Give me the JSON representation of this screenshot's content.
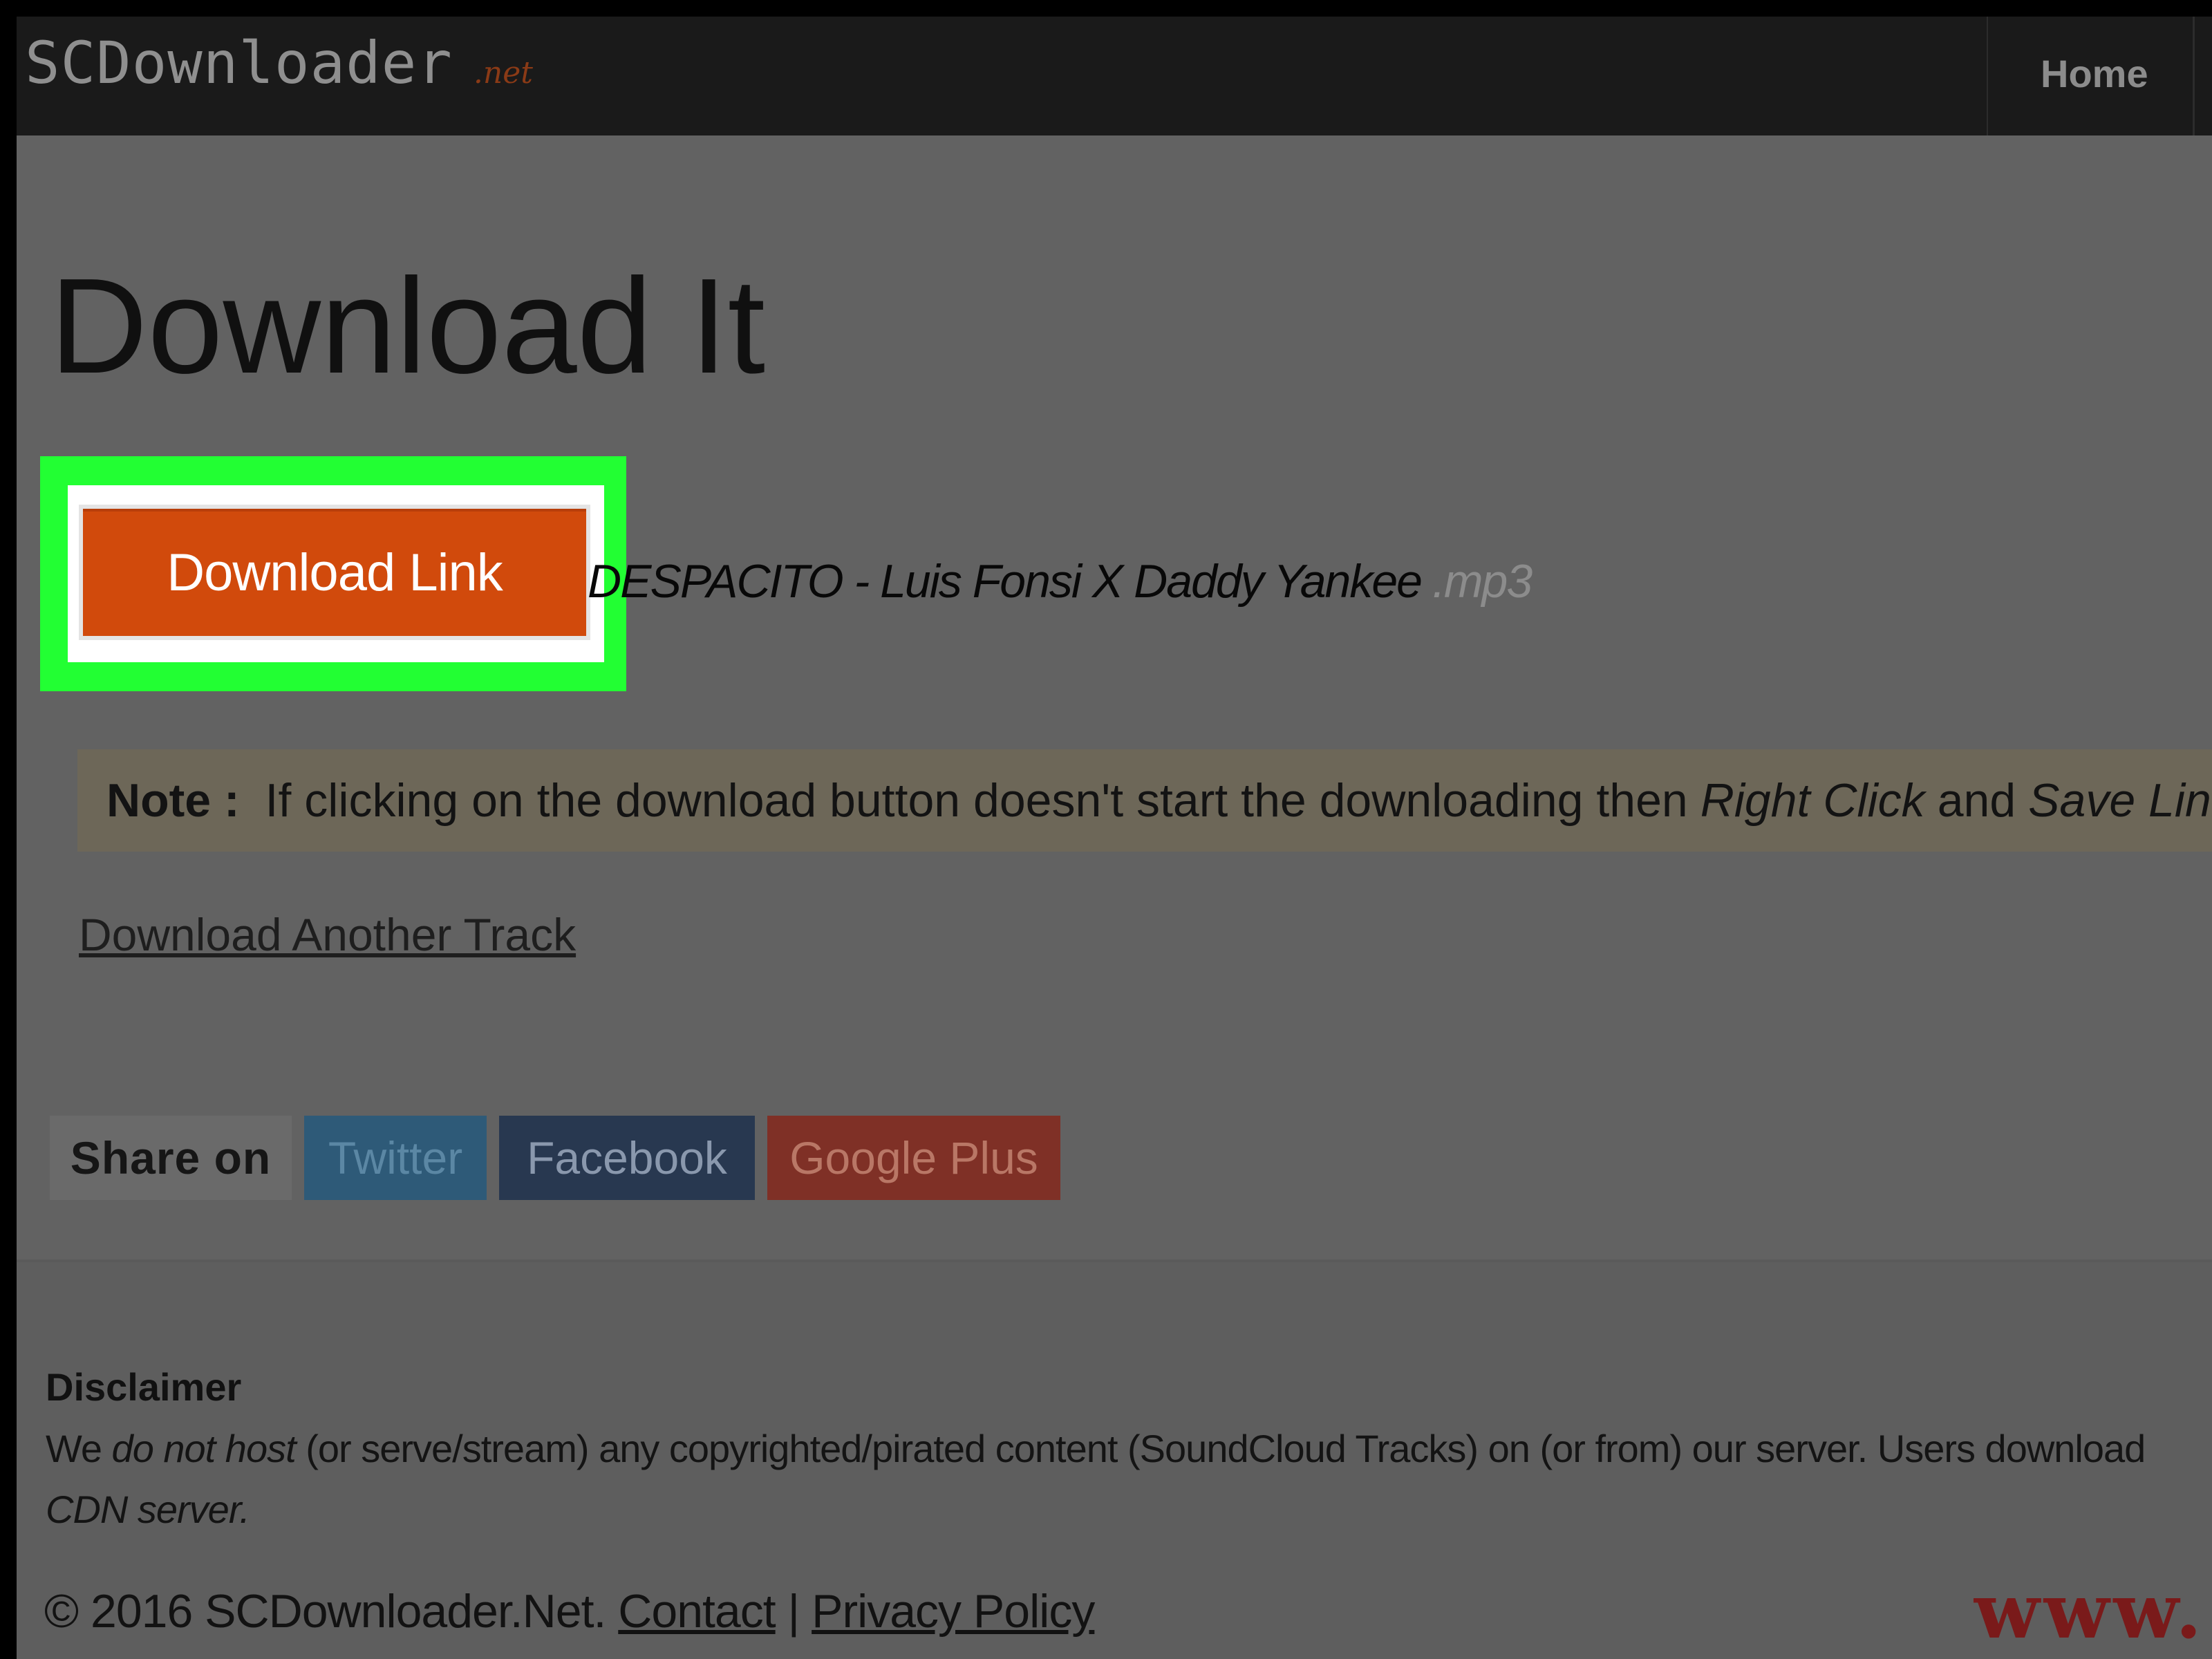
{
  "navbar": {
    "brand": "SCDownloader",
    "brand_tld": ".net",
    "home_label": "Home"
  },
  "main": {
    "title": "Download It",
    "download_button": "Download Link",
    "track_title": "DESPACITO - Luis Fonsi X Daddy Yankee",
    "track_ext": ".mp3",
    "note": {
      "label": "Note :",
      "text_before": " If clicking on the download button doesn't start the downloading then",
      "right_click": "Right Click",
      "text_and": "and",
      "save_link": "Save Link As"
    },
    "another_track": "Download Another Track"
  },
  "share": {
    "label": "Share on",
    "twitter": "Twitter",
    "facebook": "Facebook",
    "google_plus": "Google Plus"
  },
  "footer": {
    "disclaimer_title": "Disclaimer",
    "disclaimer_we": "We ",
    "disclaimer_do_not_host": "do not host",
    "disclaimer_rest": " (or serve/stream) any copyrighted/pirated content (SoundCloud Tracks) on (or from) our server. Users download",
    "disclaimer_cdn": "CDN server.",
    "copyright": "© 2016 SCDownloader.Net.",
    "contact": "Contact",
    "separator": "|",
    "privacy": "Privacy Policy",
    "watermark": "www."
  },
  "colors": {
    "download_button": "#d14a0c",
    "highlight": "#22ff33",
    "navbar": "#1a1a1a"
  }
}
